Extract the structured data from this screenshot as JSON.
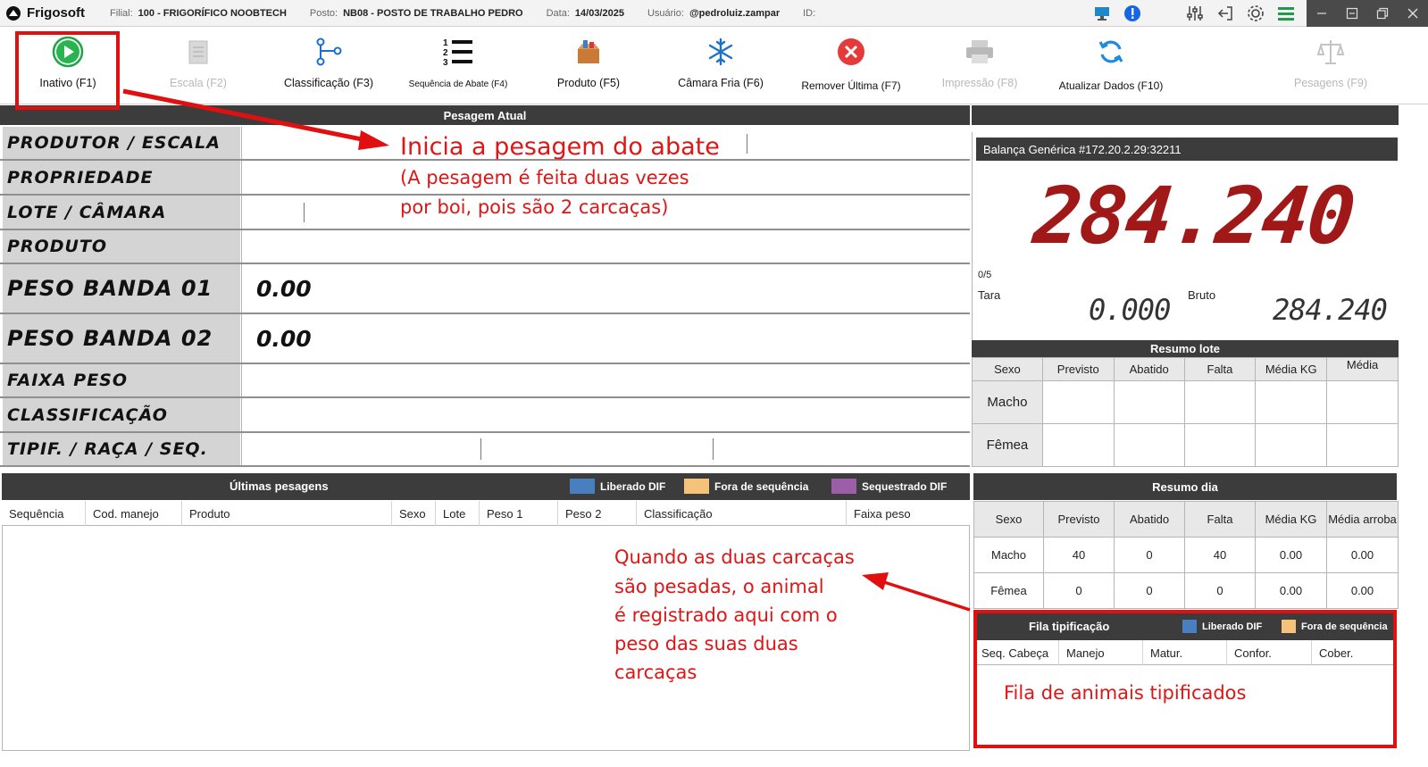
{
  "app": {
    "name": "Frigosoft"
  },
  "header": {
    "filial_label": "Filial:",
    "filial_value": "100 - FRIGORÍFICO NOOBTECH",
    "posto_label": "Posto:",
    "posto_value": "NB08 - POSTO DE TRABALHO PEDRO",
    "data_label": "Data:",
    "data_value": "14/03/2025",
    "usuario_label": "Usuário:",
    "usuario_value": "@pedroluiz.zampar",
    "id_label": "ID:"
  },
  "toolbar": [
    {
      "label": "Inativo (F1)",
      "icon": "play-icon",
      "enabled": true
    },
    {
      "label": "Escala (F2)",
      "icon": "notepad-icon",
      "enabled": false
    },
    {
      "label": "Classificação (F3)",
      "icon": "branch-icon",
      "enabled": true
    },
    {
      "label": "Sequência de Abate (F4)",
      "icon": "numbered-list-icon",
      "enabled": true
    },
    {
      "label": "Produto (F5)",
      "icon": "product-box-icon",
      "enabled": true
    },
    {
      "label": "Câmara Fria (F6)",
      "icon": "snowflake-icon",
      "enabled": true
    },
    {
      "label": "Remover Última (F7)",
      "icon": "remove-icon",
      "enabled": true
    },
    {
      "label": "Impressão (F8)",
      "icon": "printer-icon",
      "enabled": false
    },
    {
      "label": "Atualizar Dados (F10)",
      "icon": "refresh-icon",
      "enabled": true
    },
    {
      "label": "Pesagens (F9)",
      "icon": "scale-icon",
      "enabled": false
    }
  ],
  "pesagem": {
    "title": "Pesagem Atual",
    "rows": [
      {
        "label": "PRODUTOR / ESCALA",
        "value": ""
      },
      {
        "label": "PROPRIEDADE",
        "value": ""
      },
      {
        "label": "LOTE / CÂMARA",
        "value": ""
      },
      {
        "label": "PRODUTO",
        "value": ""
      },
      {
        "label": "PESO BANDA 01",
        "value": "0.00"
      },
      {
        "label": "PESO BANDA 02",
        "value": "0.00"
      },
      {
        "label": "FAIXA PESO",
        "value": ""
      },
      {
        "label": "CLASSIFICAÇÃO",
        "value": ""
      },
      {
        "label": "TIPIF. / RAÇA / SEQ.",
        "value": ""
      }
    ]
  },
  "scale": {
    "title": "Balança Genérica  #172.20.2.29:32211",
    "weight": "284.240",
    "count": "0/5",
    "tara_label": "Tara",
    "tara_value": "0.000",
    "bruto_label": "Bruto",
    "bruto_value": "284.240"
  },
  "resumo_lote": {
    "title": "Resumo lote",
    "columns": [
      "Sexo",
      "Previsto",
      "Abatido",
      "Falta",
      "Média KG",
      "Média"
    ],
    "rows": [
      [
        "Macho",
        "",
        "",
        "",
        "",
        ""
      ],
      [
        "Fêmea",
        "",
        "",
        "",
        "",
        ""
      ]
    ]
  },
  "ultimas": {
    "title": "Últimas pesagens",
    "legend": [
      {
        "label": "Liberado DIF",
        "color": "#4a7fbf"
      },
      {
        "label": "Fora de sequência",
        "color": "#f5c27a"
      },
      {
        "label": "Sequestrado DIF",
        "color": "#9b5fa8"
      }
    ],
    "columns": [
      "Sequência",
      "Cod. manejo",
      "Produto",
      "Sexo",
      "Lote",
      "Peso 1",
      "Peso 2",
      "Classificação",
      "Faixa peso"
    ]
  },
  "resumo_dia": {
    "title": "Resumo dia",
    "columns": [
      "Sexo",
      "Previsto",
      "Abatido",
      "Falta",
      "Média KG",
      "Média arroba"
    ],
    "rows": [
      [
        "Macho",
        "40",
        "0",
        "40",
        "0.00",
        "0.00"
      ],
      [
        "Fêmea",
        "0",
        "0",
        "0",
        "0.00",
        "0.00"
      ]
    ]
  },
  "fila": {
    "title": "Fila tipificação",
    "legend": [
      {
        "label": "Liberado DIF",
        "color": "#4a7fbf"
      },
      {
        "label": "Fora de sequência",
        "color": "#f5c27a"
      }
    ],
    "columns": [
      "Seq. Cabeça",
      "Manejo",
      "Matur.",
      "Confor.",
      "Cober."
    ]
  },
  "annotations": {
    "start": "Inicia a pesagem do abate",
    "start_note_1": "(A pesagem é feita duas vezes",
    "start_note_2": "por boi, pois são 2 carcaças)",
    "registered_1": "Quando as duas carcaças",
    "registered_2": "são pesadas, o animal",
    "registered_3": "é registrado aqui com o",
    "registered_4": "peso das suas duas",
    "registered_5": "carcaças",
    "queue": "Fila de animais tipificados"
  },
  "colors": {
    "annotation": "#e01515",
    "weight_display": "#a01818",
    "header_bar": "#3c3c3c"
  }
}
